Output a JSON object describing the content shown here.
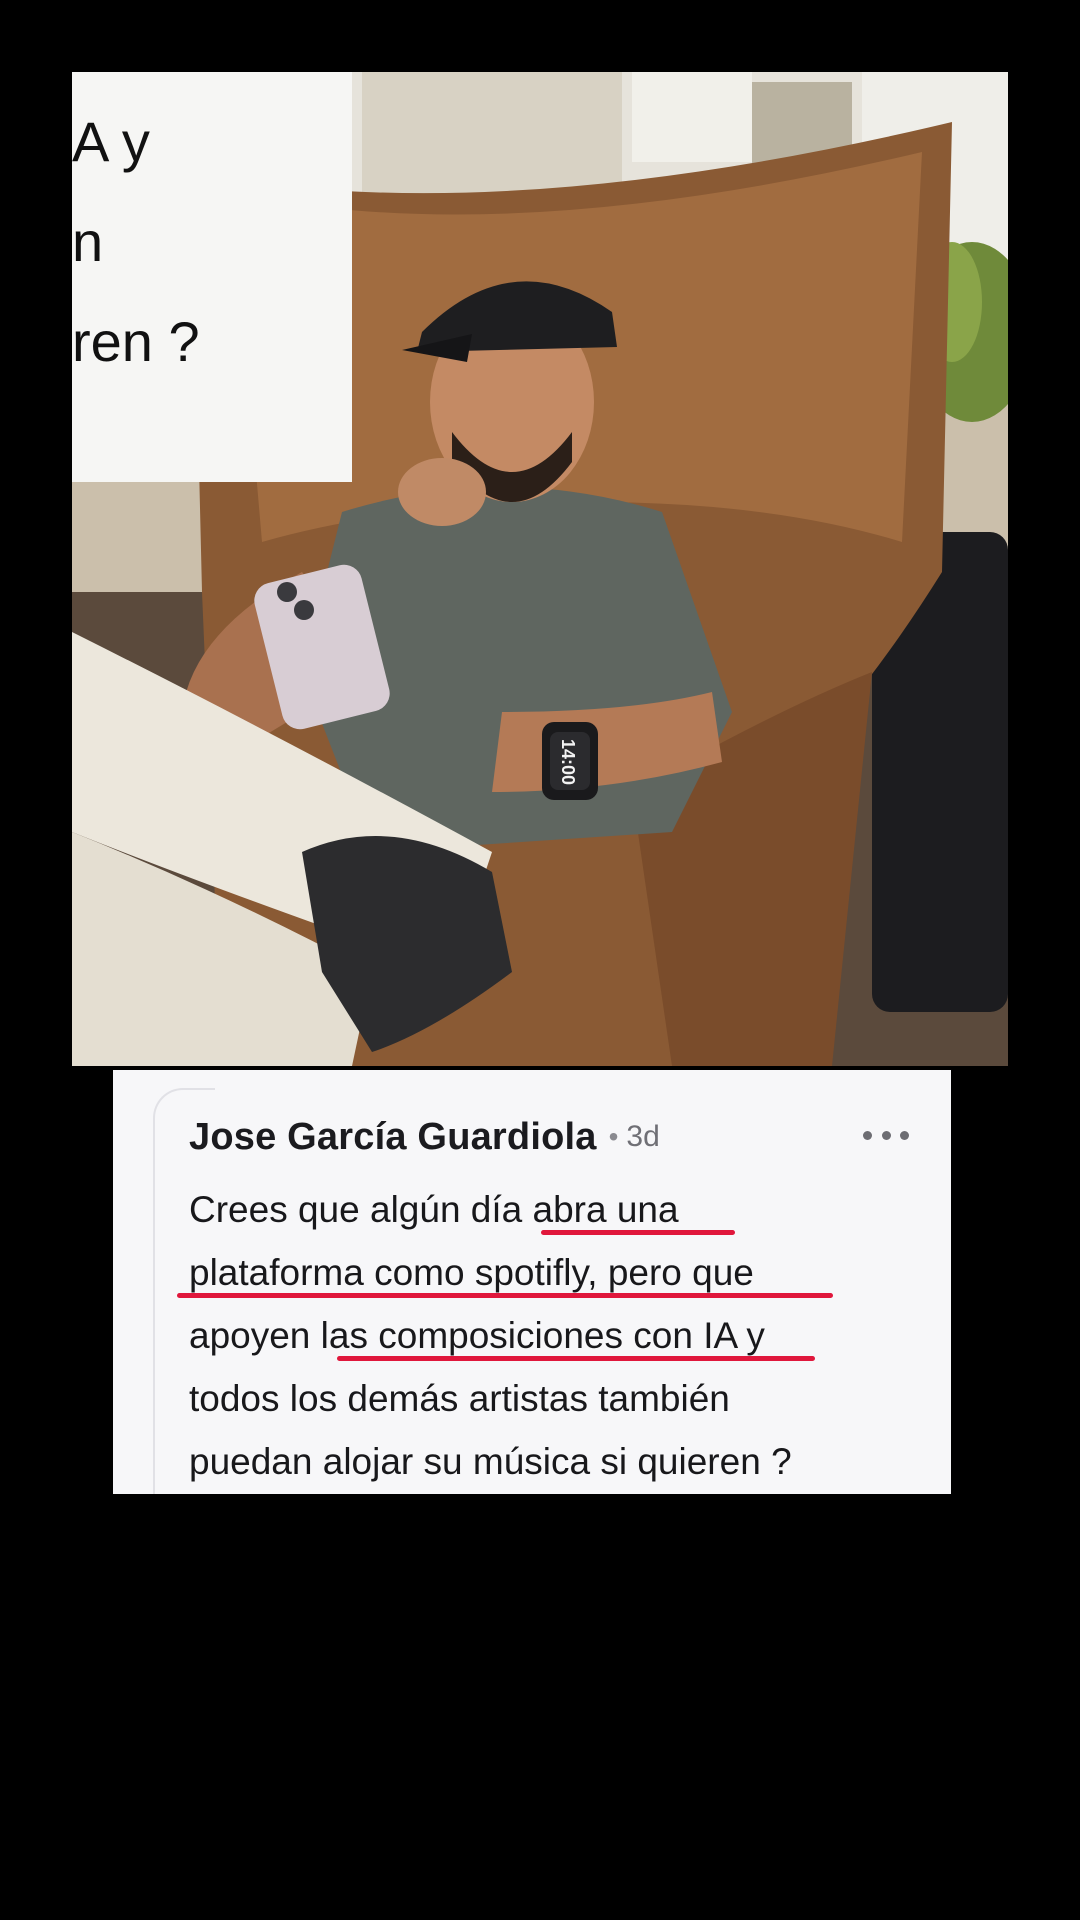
{
  "video": {
    "overlay_fragments": [
      "A y",
      "n",
      "ren ?"
    ],
    "watch_time": "14:00"
  },
  "comment": {
    "author": "Jose García Guardiola",
    "separator": "•",
    "age": "3d",
    "more_icon": "more-horizontal-icon",
    "lines": [
      "Crees que algún día abra una",
      "plataforma como spotifly, pero que",
      "apoyen las composiciones con IA y",
      "todos los demás artistas también",
      "puedan alojar su música si quieren ?"
    ],
    "highlight_color": "#e0173c"
  }
}
